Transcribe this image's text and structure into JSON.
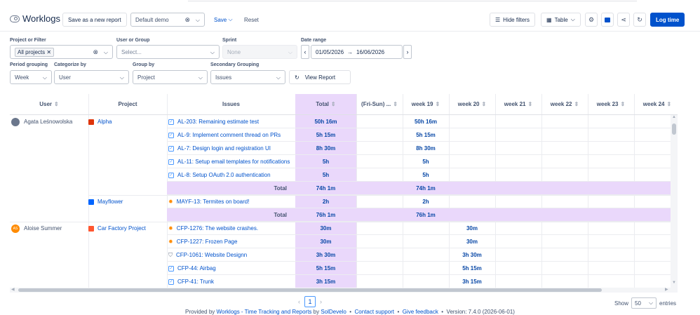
{
  "app": {
    "title": "Worklogs"
  },
  "header": {
    "save_as_new_report": "Save as a new report",
    "report_select": "Default demo",
    "save": "Save",
    "reset": "Reset",
    "hide_filters": "Hide filters",
    "view_mode": "Table",
    "log_time": "Log time"
  },
  "filters": {
    "project_label": "Project or Filter",
    "project_chip": "All projects",
    "user_label": "User or Group",
    "user_placeholder": "Select...",
    "sprint_label": "Sprint",
    "sprint_value": "None",
    "date_label": "Date range",
    "date_from": "01/05/2026",
    "date_to": "16/06/2026",
    "period_label": "Period grouping",
    "period_value": "Week",
    "categorize_label": "Categorize by",
    "categorize_value": "User",
    "group_label": "Group by",
    "group_value": "Project",
    "secondary_label": "Secondary Grouping",
    "secondary_value": "Issues",
    "view_report": "View Report"
  },
  "table": {
    "columns": [
      "User",
      "Project",
      "Issues",
      "Total",
      "(Fri-Sun) ...",
      "week 19",
      "week 20",
      "week 21",
      "week 22",
      "week 23",
      "week 24"
    ],
    "total_label": "Total",
    "users": [
      {
        "name": "Agata Leśnowolska",
        "initials": "",
        "avatar_color": "#6b778c"
      },
      {
        "name": "Aloise Summer",
        "initials": "AS",
        "avatar_color": "#ff8b00"
      }
    ],
    "projects": [
      {
        "name": "Alpha",
        "color": "#de350b"
      },
      {
        "name": "Mayflower",
        "color": "#0065ff"
      },
      {
        "name": "Car Factory Project",
        "color": "#ff5630"
      }
    ],
    "rows": [
      {
        "issue": "AL-203: Remaining estimate test",
        "type": "task",
        "total": "50h 16m",
        "week": "50h 16m"
      },
      {
        "issue": "AL-9: Implement comment thread on PRs",
        "type": "task",
        "total": "5h 15m",
        "week": "5h 15m"
      },
      {
        "issue": "AL-7: Design login and registration UI",
        "type": "task",
        "total": "8h 30m",
        "week": "8h 30m"
      },
      {
        "issue": "AL-11: Setup email templates for notifications",
        "type": "task",
        "total": "5h",
        "week": "5h"
      },
      {
        "issue": "AL-8: Setup OAuth 2.0 authentication",
        "type": "task",
        "total": "5h",
        "week": "5h"
      },
      {
        "total_row": true,
        "total": "74h 1m",
        "week": "74h 1m"
      },
      {
        "issue": "MAYF-13: Termites on board!",
        "type": "bug",
        "total": "2h",
        "week": "2h"
      },
      {
        "total_row": true,
        "total": "76h 1m",
        "week": "76h 1m"
      },
      {
        "issue": "CFP-1276: The website crashes.",
        "type": "bug",
        "total": "30m",
        "week20": "30m"
      },
      {
        "issue": "CFP-1227: Frozen Page",
        "type": "bug",
        "total": "30m",
        "week20": "30m"
      },
      {
        "issue": "CFP-1061: Website Designn",
        "type": "story",
        "total": "3h 30m",
        "week20": "3h 30m"
      },
      {
        "issue": "CFP-44: Airbag",
        "type": "task",
        "total": "5h 15m",
        "week20": "5h 15m"
      },
      {
        "issue": "CFP-41: Trunk",
        "type": "task",
        "total": "3h 15m",
        "week20": "3h 15m"
      }
    ]
  },
  "pager": {
    "prev": "‹",
    "page": "1",
    "next": "›"
  },
  "show": {
    "label": "Show",
    "value": "50",
    "suffix": "entries"
  },
  "footer": {
    "provided": "Provided by",
    "app_link": "Worklogs - Time Tracking and Reports",
    "by": "by",
    "vendor": "SolDevelo",
    "contact": "Contact support",
    "feedback": "Give feedback",
    "version": "Version: 7.4.0 (2026-06-01)"
  },
  "colors": {
    "accent": "#0052cc",
    "total_bg": "#ead8fb"
  }
}
